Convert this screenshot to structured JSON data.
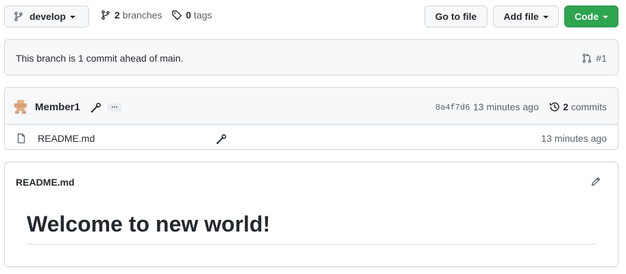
{
  "toolbar": {
    "branch_label": "develop",
    "branches_count": "2",
    "branches_label": "branches",
    "tags_count": "0",
    "tags_label": "tags",
    "go_to_file_label": "Go to file",
    "add_file_label": "Add file",
    "code_label": "Code"
  },
  "ahead_notice": {
    "text": "This branch is 1 commit ahead of main.",
    "pr_label": "#1"
  },
  "latest_commit": {
    "author": "Member1",
    "ellipsis": "…",
    "sha": "8a4f7d6",
    "time": "13 minutes ago",
    "commits_count": "2",
    "commits_label": "commits"
  },
  "files": [
    {
      "name": "README.md",
      "time": "13 minutes ago"
    }
  ],
  "readme": {
    "title": "README.md",
    "heading": "Welcome to new world!"
  },
  "colors": {
    "primary_button": "#2da44e",
    "border": "#d0d7de",
    "muted_text": "#57606a",
    "header_bg": "#f6f8fa"
  },
  "icons": {
    "branch": "git-branch-icon",
    "tag": "tag-icon",
    "pull_request": "git-pull-request-icon",
    "history": "history-icon",
    "file": "file-icon",
    "edit": "pencil-icon",
    "tool": "wrench-icon"
  }
}
